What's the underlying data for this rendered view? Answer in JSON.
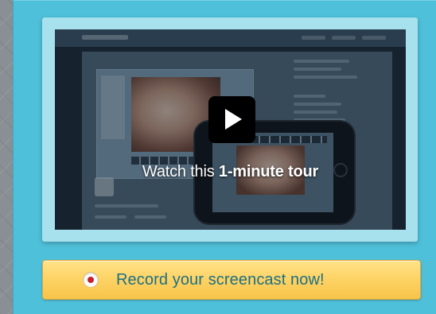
{
  "video": {
    "tour_text_prefix": "Watch this ",
    "tour_text_bold": "1-minute tour"
  },
  "record": {
    "label": "Record your screencast now!"
  },
  "colors": {
    "panel": "#4fc0d9",
    "frame": "#a8e1ee",
    "button_gradient_top": "#ffe28a",
    "button_gradient_bottom": "#f7c44a",
    "button_text": "#1c6f86",
    "record_dot": "#c8202a"
  },
  "icons": {
    "play": "play-icon",
    "record": "record-icon"
  }
}
